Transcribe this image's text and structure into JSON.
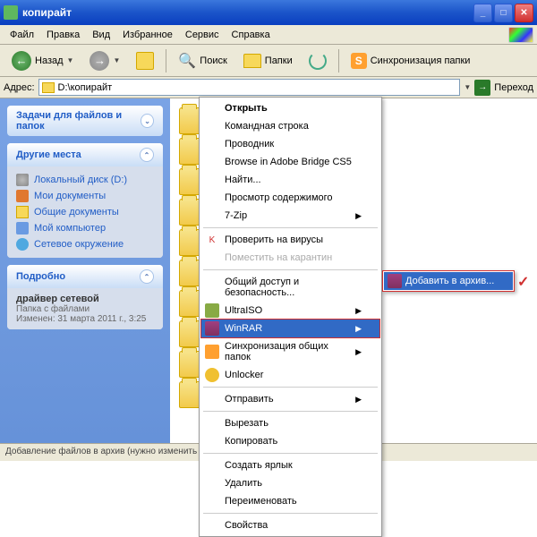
{
  "window": {
    "title": "копирайт"
  },
  "menubar": {
    "file": "Файл",
    "edit": "Правка",
    "view": "Вид",
    "favorites": "Избранное",
    "tools": "Сервис",
    "help": "Справка"
  },
  "toolbar": {
    "back": "Назад",
    "search": "Поиск",
    "folders": "Папки",
    "sync": "Синхронизация папки"
  },
  "addressbar": {
    "label": "Адрес:",
    "path": "D:\\копирайт",
    "go": "Переход"
  },
  "sidebar": {
    "tasks": {
      "title": "Задачи для файлов и папок"
    },
    "places": {
      "title": "Другие места",
      "items": [
        "Локальный диск (D:)",
        "Мои документы",
        "Общие документы",
        "Мой компьютер",
        "Сетевое окружение"
      ]
    },
    "details": {
      "title": "Подробно",
      "selected": "драйвер сетевой",
      "type": "Папка с файлами",
      "modified": "Изменен: 31 марта 2011 г., 3:25"
    }
  },
  "context_menu": {
    "open": "Открыть",
    "cmd": "Командная строка",
    "explorer": "Проводник",
    "bridge": "Browse in Adobe Bridge CS5",
    "find": "Найти...",
    "view_content": "Просмотр содержимого",
    "sevenzip": "7-Zip",
    "scan_virus": "Проверить на вирусы",
    "quarantine": "Поместить на карантин",
    "sharing": "Общий доступ и безопасность...",
    "ultraiso": "UltraISO",
    "winrar": "WinRAR",
    "sync_folders": "Синхронизация общих папок",
    "unlocker": "Unlocker",
    "send_to": "Отправить",
    "cut": "Вырезать",
    "copy": "Копировать",
    "shortcut": "Создать ярлык",
    "delete": "Удалить",
    "rename": "Переименовать",
    "properties": "Свойства"
  },
  "submenu": {
    "add_to_archive": "Добавить в архив..."
  },
  "statusbar": {
    "text": "Добавление файлов в архив (нужно изменить дополнит"
  }
}
